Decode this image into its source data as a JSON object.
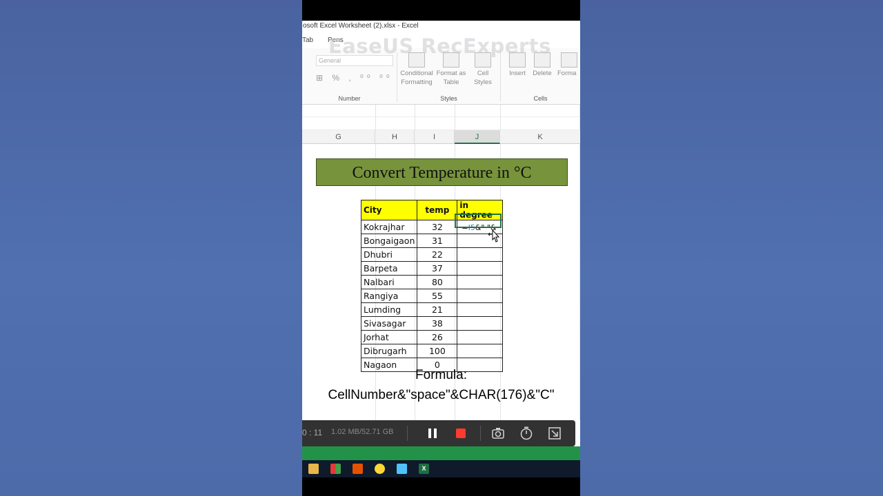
{
  "window": {
    "title": "osoft Excel Worksheet (2).xlsx - Excel"
  },
  "tabs": [
    "Tab",
    "Pens"
  ],
  "watermark": "EaseUS RecExperts",
  "ribbon": {
    "number_group": {
      "label": "Number",
      "format_box": "General"
    },
    "styles_group": {
      "label": "Styles",
      "buttons": [
        "Conditional Formatting",
        "Format as Table",
        "Cell Styles"
      ]
    },
    "cells_group": {
      "label": "Cells",
      "buttons": [
        "Insert",
        "Delete",
        "Forma"
      ]
    }
  },
  "sheet": {
    "columns": [
      "G",
      "H",
      "I",
      "J",
      "K"
    ],
    "selected_column": "J",
    "banner_title": "Convert Temperature in °C",
    "table": {
      "headers": [
        "City",
        "temp",
        "in degree"
      ],
      "rows": [
        {
          "city": "Kokrajhar",
          "temp": "32"
        },
        {
          "city": "Bongaigaon",
          "temp": "31"
        },
        {
          "city": "Dhubri",
          "temp": "22"
        },
        {
          "city": "Barpeta",
          "temp": "37"
        },
        {
          "city": "Nalbari",
          "temp": "80"
        },
        {
          "city": "Rangiya",
          "temp": "55"
        },
        {
          "city": "Lumding",
          "temp": "21"
        },
        {
          "city": "Sivasagar",
          "temp": "38"
        },
        {
          "city": "Jorhat",
          "temp": "26"
        },
        {
          "city": "Dibrugarh",
          "temp": "100"
        },
        {
          "city": "Nagaon",
          "temp": "0"
        }
      ]
    },
    "formula_editing": {
      "prefix": "=",
      "ref": "I5",
      "suffix": "&\" \"&"
    }
  },
  "caption": {
    "line1": "Formula:",
    "line2": "CellNumber&\"space\"&CHAR(176)&\"C\""
  },
  "recorder": {
    "time": "0 : 11",
    "size": "1.02 MB/52.71 GB"
  },
  "colors": {
    "excel_green": "#217346",
    "banner_green": "#77933c",
    "header_yellow": "#ffff00",
    "record_red": "#ff3b30"
  }
}
